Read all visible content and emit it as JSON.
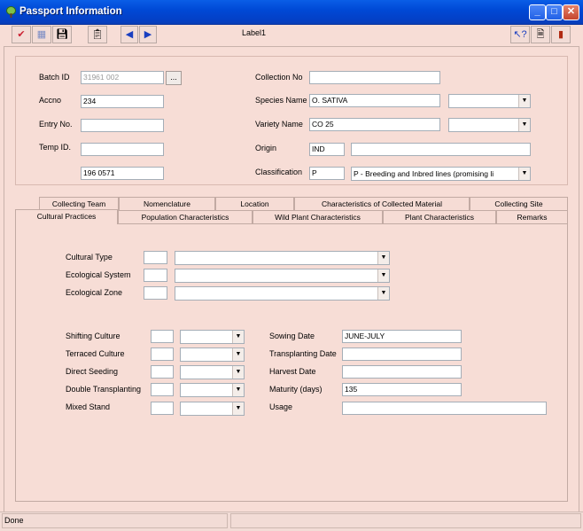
{
  "window": {
    "title": "Passport Information",
    "minimize": "_",
    "maximize": "□",
    "close": "✕"
  },
  "toolbar": {
    "label": "Label1",
    "icons": [
      "check-icon",
      "grid-icon",
      "save-icon",
      "clipboard-icon",
      "prev-arrow-icon",
      "next-arrow-icon",
      "help-pointer-icon",
      "document-icon",
      "exit-door-icon"
    ]
  },
  "header": {
    "batch_id": {
      "label": "Batch ID",
      "value": "31961 002",
      "browse": "..."
    },
    "accno": {
      "label": "Accno",
      "value": "234"
    },
    "entry_no": {
      "label": "Entry No.",
      "value": ""
    },
    "temp_id": {
      "label": "Temp ID.",
      "value": ""
    },
    "extra_field": {
      "value": "196 0571"
    },
    "collection_no": {
      "label": "Collection No",
      "value": ""
    },
    "species_name": {
      "label": "Species Name",
      "value": "O. SATIVA",
      "select": ""
    },
    "variety_name": {
      "label": "Variety Name",
      "value": "CO 25",
      "select": ""
    },
    "origin": {
      "label": "Origin",
      "code": "IND",
      "value": ""
    },
    "classification": {
      "label": "Classification",
      "code": "P",
      "value": "P - Breeding and Inbred lines (promising li"
    }
  },
  "tabs_row1": [
    "Collecting Team",
    "Nomenclature",
    "Location",
    "Characteristics of Collected Material",
    "Collecting Site"
  ],
  "tabs_row2": [
    "Cultural Practices",
    "Population Characteristics",
    "Wild Plant Characteristics",
    "Plant Characteristics",
    "Remarks"
  ],
  "cultural": {
    "cultural_type": {
      "label": "Cultural Type",
      "code": "",
      "value": ""
    },
    "ecological_system": {
      "label": "Ecological System",
      "code": "",
      "value": ""
    },
    "ecological_zone": {
      "label": "Ecological Zone",
      "code": "",
      "value": ""
    },
    "shifting_culture": {
      "label": "Shifting Culture",
      "code": "",
      "value": ""
    },
    "terraced_culture": {
      "label": "Terraced Culture",
      "code": "",
      "value": ""
    },
    "direct_seeding": {
      "label": "Direct Seeding",
      "code": "",
      "value": ""
    },
    "double_transplanting": {
      "label": "Double Transplanting",
      "code": "",
      "value": ""
    },
    "mixed_stand": {
      "label": "Mixed Stand",
      "code": "",
      "value": ""
    },
    "sowing_date": {
      "label": "Sowing Date",
      "value": "JUNE-JULY"
    },
    "transplanting_date": {
      "label": "Transplanting Date",
      "value": ""
    },
    "harvest_date": {
      "label": "Harvest Date",
      "value": ""
    },
    "maturity": {
      "label": "Maturity (days)",
      "value": "135"
    },
    "usage": {
      "label": "Usage",
      "value": ""
    }
  },
  "status": {
    "text": "Done",
    "panel2": ""
  }
}
